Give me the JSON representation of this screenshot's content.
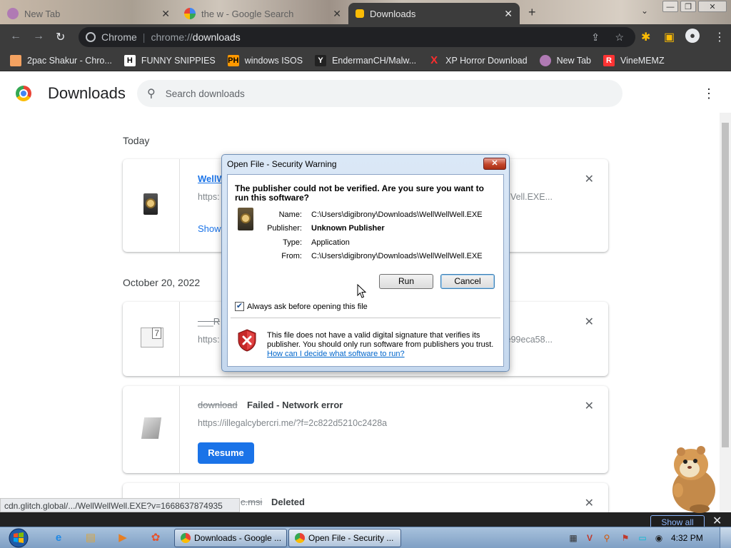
{
  "tabs": [
    {
      "title": "New Tab",
      "active": false
    },
    {
      "title": "the w - Google Search",
      "active": false
    },
    {
      "title": "Downloads",
      "active": true
    }
  ],
  "omnibox": {
    "site": "Chrome",
    "url_prefix": "chrome://",
    "url_path": "downloads"
  },
  "bookmarks": [
    {
      "label": "2pac Shakur - Chro...",
      "icon": "2pac-icon",
      "color": "#f4a261"
    },
    {
      "label": "FUNNY SNIPPIES",
      "icon": "H",
      "color": "#ffffff"
    },
    {
      "label": "windows ISOS",
      "icon": "PH",
      "color": "#ff9900"
    },
    {
      "label": "EndermanCH/Malw...",
      "icon": "Y",
      "color": "#e8eaed"
    },
    {
      "label": "XP Horror Download",
      "icon": "X",
      "color": "#ff2d2d"
    },
    {
      "label": "New Tab",
      "icon": "globe-icon",
      "color": "#b07ab4"
    },
    {
      "label": "VineMEMZ",
      "icon": "R",
      "color": "#ff3333"
    }
  ],
  "downloads_page": {
    "title": "Downloads",
    "search_placeholder": "Search downloads",
    "sections": [
      "Today",
      "October 20, 2022"
    ],
    "items": [
      {
        "name": "WellW",
        "url": "https:",
        "url_end": "Vell.EXE...",
        "link": "Show"
      },
      {
        "name": "___R",
        "url": "https:",
        "url_end": "e99eca58..."
      },
      {
        "name": "download",
        "status": "Failed - Network error",
        "url": "https://illegalcybercri.me/?f=2c822d5210c2428a",
        "action": "Resume"
      },
      {
        "name": "c.msi",
        "status": "Deleted"
      }
    ]
  },
  "statusbar": "cdn.glitch.global/.../WellWellWell.EXE?v=1668637874935",
  "shelf": {
    "show_all": "Show all"
  },
  "dialog": {
    "title": "Open File - Security Warning",
    "question": "The publisher could not be verified.  Are you sure you want to run this software?",
    "fields": [
      {
        "label": "Name:",
        "value": "C:\\Users\\digibrony\\Downloads\\WellWellWell.EXE",
        "bold": false
      },
      {
        "label": "Publisher:",
        "value": "Unknown Publisher",
        "bold": true
      },
      {
        "label": "Type:",
        "value": "Application",
        "bold": false
      },
      {
        "label": "From:",
        "value": "C:\\Users\\digibrony\\Downloads\\WellWellWell.EXE",
        "bold": false
      }
    ],
    "run_label": "Run",
    "cancel_label": "Cancel",
    "checkbox_label": "Always ask before opening this file",
    "checkbox_checked": true,
    "warning_text": "This file does not have a valid digital signature that verifies its publisher.  You should only run software from publishers you trust.",
    "help_link": "How can I decide what software to run?"
  },
  "taskbar": {
    "buttons": [
      {
        "label": "Downloads - Google ...",
        "active": false
      },
      {
        "label": "Open File - Security ...",
        "active": true
      }
    ],
    "clock": "4:32 PM"
  }
}
